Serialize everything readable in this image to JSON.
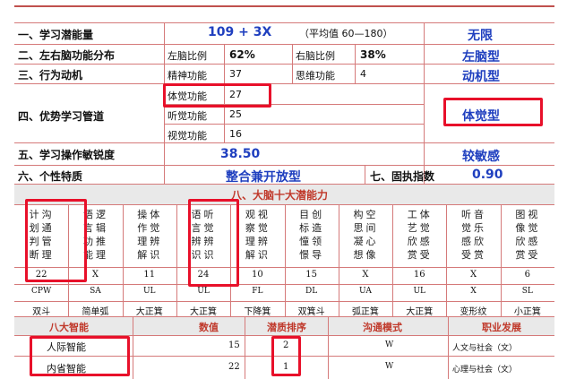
{
  "rows": {
    "r1": {
      "label": "一、学习潜能量",
      "value": "109 + 3X",
      "note": "（平均值 60—180）",
      "result": "无限"
    },
    "r2": {
      "label": "二、左右脑功能分布",
      "left_label": "左脑比例",
      "left_value": "62%",
      "right_label": "右脑比例",
      "right_value": "38%",
      "result": "左脑型"
    },
    "r3": {
      "label": "三、行为动机",
      "a_label": "精神功能",
      "a_value": "37",
      "b_label": "思维功能",
      "b_value": "4",
      "result": "动机型"
    },
    "r4": {
      "label": "四、优势学习管道",
      "items": [
        {
          "label": "体觉功能",
          "value": "27"
        },
        {
          "label": "听觉功能",
          "value": "25"
        },
        {
          "label": "视觉功能",
          "value": "16"
        }
      ],
      "result": "体觉型"
    },
    "r5": {
      "label": "五、学习操作敏锐度",
      "value": "38.50",
      "result": "较敏感"
    },
    "r6": {
      "label": "六、个性特质",
      "value": "整合兼开放型",
      "mid_label": "七、固执指数",
      "result": "0.90"
    }
  },
  "section8": {
    "title": "八、大脑十大潜能力",
    "columns": [
      {
        "lines": [
          "计划判断",
          "沟通管理"
        ],
        "value": "22",
        "code": "CPW",
        "rank": "双斗"
      },
      {
        "lines": [
          "语言功能",
          "逻辑推理"
        ],
        "value": "X",
        "code": "SA",
        "rank": "简单弧"
      },
      {
        "lines": [
          "操作理解",
          "体觉辨识"
        ],
        "value": "11",
        "code": "UL",
        "rank": "大正箕"
      },
      {
        "lines": [
          "语言辨识",
          "听觉辨识"
        ],
        "value": "24",
        "code": "UL",
        "rank": "大正箕"
      },
      {
        "lines": [
          "观察理解",
          "视觉辨识"
        ],
        "value": "10",
        "code": "FL",
        "rank": "下降箕"
      },
      {
        "lines": [
          "目标憧憬",
          "创造领导"
        ],
        "value": "15",
        "code": "DL",
        "rank": "双箕斗"
      },
      {
        "lines": [
          "构思凝想",
          "空间心像"
        ],
        "value": "X",
        "code": "UA",
        "rank": "弧正箕"
      },
      {
        "lines": [
          "工艺欣赏",
          "体觉感受"
        ],
        "value": "16",
        "code": "UL",
        "rank": "大正箕"
      },
      {
        "lines": [
          "听觉感受",
          "音乐欣赏"
        ],
        "value": "X",
        "code": "X",
        "rank": "变形纹"
      },
      {
        "lines": [
          "图像欣赏",
          "视觉感受"
        ],
        "value": "6",
        "code": "SL",
        "rank": "小正箕"
      }
    ]
  },
  "section9": {
    "headers": [
      "八大智能",
      "数值",
      "潜质排序",
      "沟通模式",
      "职业发展"
    ],
    "rows": [
      {
        "name": "人际智能",
        "value": "15",
        "rank": "2",
        "mode": "W",
        "career": "人文与社会（文）"
      },
      {
        "name": "内省智能",
        "value": "22",
        "rank": "1",
        "mode": "W",
        "career": "心理与社会（文）"
      }
    ]
  },
  "colors": {
    "accent_red": "#e8102a",
    "text_blue": "#1f3fbf",
    "border": "#d57a7a",
    "section_red": "#c0392b"
  }
}
